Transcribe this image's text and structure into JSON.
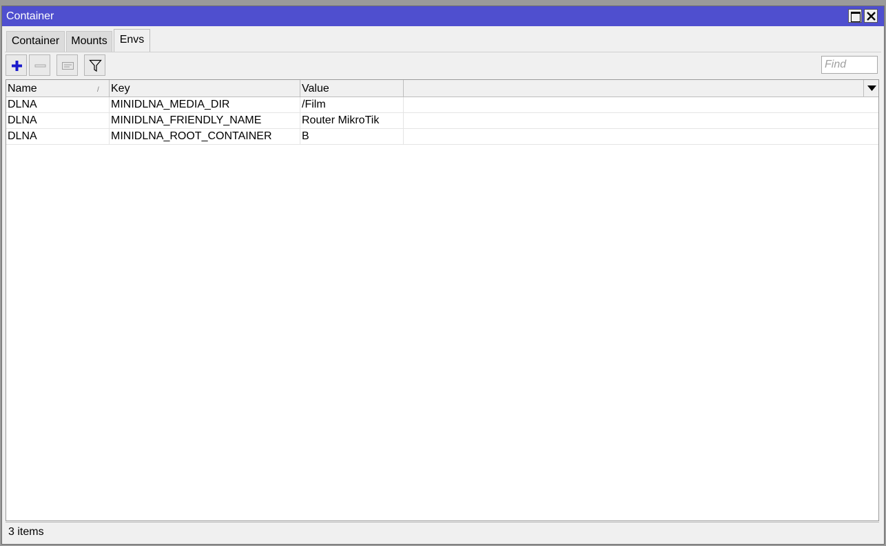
{
  "window": {
    "title": "Container"
  },
  "tabs": [
    {
      "label": "Container",
      "active": false
    },
    {
      "label": "Mounts",
      "active": false
    },
    {
      "label": "Envs",
      "active": true
    }
  ],
  "toolbar": {
    "add_icon": "plus-icon",
    "remove_icon": "minus-icon",
    "comment_icon": "comment-icon",
    "filter_icon": "filter-icon",
    "find_placeholder": "Find"
  },
  "table": {
    "columns": [
      "Name",
      "Key",
      "Value"
    ],
    "rows": [
      {
        "name": "DLNA",
        "key": "MINIDLNA_MEDIA_DIR",
        "value": "/Film"
      },
      {
        "name": "DLNA",
        "key": "MINIDLNA_FRIENDLY_NAME",
        "value": "Router MikroTik"
      },
      {
        "name": "DLNA",
        "key": "MINIDLNA_ROOT_CONTAINER",
        "value": "B"
      }
    ]
  },
  "status": {
    "text": "3 items"
  },
  "colors": {
    "titlebar": "#4f4fcf",
    "add_icon": "#1a1acc"
  }
}
